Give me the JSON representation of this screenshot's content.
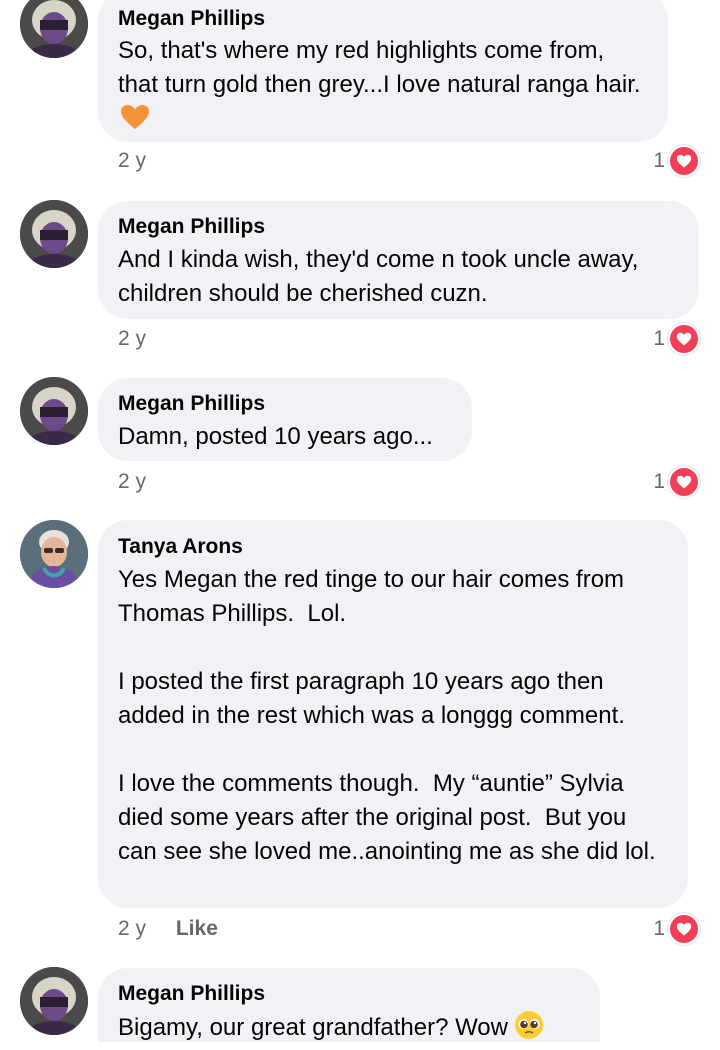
{
  "comments": [
    {
      "author": "Megan Phillips",
      "text": "So, that's where my red highlights come from, that turn gold then grey...I love natural ranga hair.",
      "emoji": "orange-heart",
      "time": "2 y",
      "reaction_count": "1",
      "reaction": "love-icon"
    },
    {
      "author": "Megan Phillips",
      "text": "And I kinda wish, they'd come n took uncle away, children should be cherished cuzn.",
      "time": "2 y",
      "reaction_count": "1",
      "reaction": "love-icon"
    },
    {
      "author": "Megan Phillips",
      "text": "Damn, posted 10 years ago...",
      "time": "2 y",
      "reaction_count": "1",
      "reaction": "love-icon"
    },
    {
      "author": "Tanya Arons",
      "text": "Yes Megan the red tinge to our hair comes from Thomas Phillips.  Lol.\n\nI posted the first paragraph 10 years ago then added in the rest which was a longgg comment.\n\nI love the comments though.  My “auntie” Sylvia died some years after the original post.  But you can see she loved me..anointing me as she did lol.",
      "time": "2 y",
      "like_label": "Like",
      "reaction_count": "1",
      "reaction": "love-icon"
    },
    {
      "author": "Megan Phillips",
      "text": "Bigamy, our great grandfather? Wow",
      "emoji": "pleading-face"
    }
  ],
  "colors": {
    "bubble": "#f0f2f5",
    "meta_text": "#65676b",
    "love": "#f33e58",
    "orange_heart": "#f7923a"
  }
}
